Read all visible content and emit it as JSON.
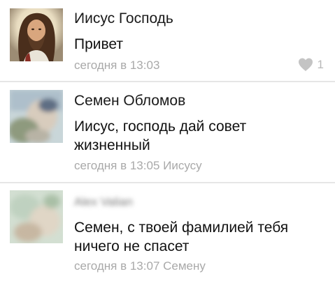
{
  "comments": [
    {
      "author": "Иисус Господь",
      "text": "Привет",
      "time": "сегодня в 13:03",
      "reply_to": "",
      "likes": "1",
      "avatar_icon": "jesus-portrait-icon"
    },
    {
      "author": "Семен Обломов",
      "text": "Иисус, господь дай совет жизненный",
      "time": "сегодня в 13:05",
      "reply_to": "Иисусу",
      "likes": "",
      "avatar_icon": "blurred-user-photo-icon"
    },
    {
      "author": "Alex Valian",
      "text": "Семен, с твоей фамилией тебя ничего не спасет",
      "time": "сегодня в 13:07",
      "reply_to": "Семену",
      "likes": "",
      "avatar_icon": "blurred-user-photo-icon"
    }
  ],
  "colors": {
    "meta": "#a9a9a9",
    "divider": "#e6e6e6",
    "like_icon": "#c4c4c4"
  }
}
